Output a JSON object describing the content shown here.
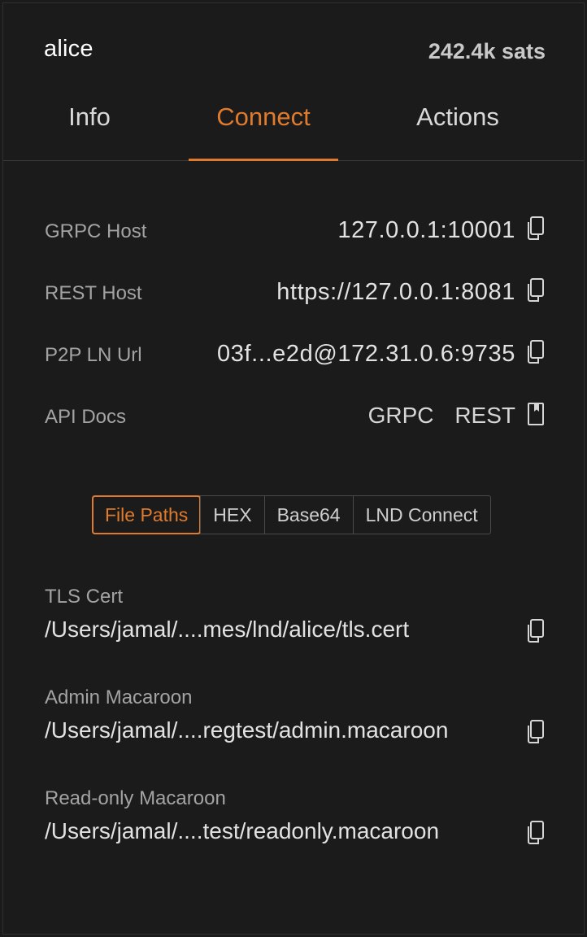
{
  "node": {
    "name": "alice",
    "balance": "242.4k sats"
  },
  "tabs": [
    {
      "label": "Info",
      "active": false
    },
    {
      "label": "Connect",
      "active": true
    },
    {
      "label": "Actions",
      "active": false
    }
  ],
  "connection": {
    "grpc_host": {
      "label": "GRPC Host",
      "value": "127.0.0.1:10001"
    },
    "rest_host": {
      "label": "REST Host",
      "value": "https://127.0.0.1:8081"
    },
    "p2p_url": {
      "label": "P2P LN Url",
      "value": "03f...e2d@172.31.0.6:9735"
    },
    "api_docs": {
      "label": "API Docs",
      "grpc": "GRPC",
      "rest": "REST"
    }
  },
  "formats": {
    "options": [
      "File Paths",
      "HEX",
      "Base64",
      "LND Connect"
    ],
    "selected": "File Paths"
  },
  "credentials": {
    "tls_cert": {
      "label": "TLS Cert",
      "value": "/Users/jamal/....mes/lnd/alice/tls.cert"
    },
    "admin_macaroon": {
      "label": "Admin Macaroon",
      "value": "/Users/jamal/....regtest/admin.macaroon"
    },
    "readonly_macaroon": {
      "label": "Read-only Macaroon",
      "value": "/Users/jamal/....test/readonly.macaroon"
    }
  },
  "colors": {
    "accent": "#e07b2d",
    "background": "#1b1b1b",
    "muted_text": "#a3a3a3"
  },
  "icons": {
    "copy": "copy-icon",
    "docs": "book-icon"
  }
}
